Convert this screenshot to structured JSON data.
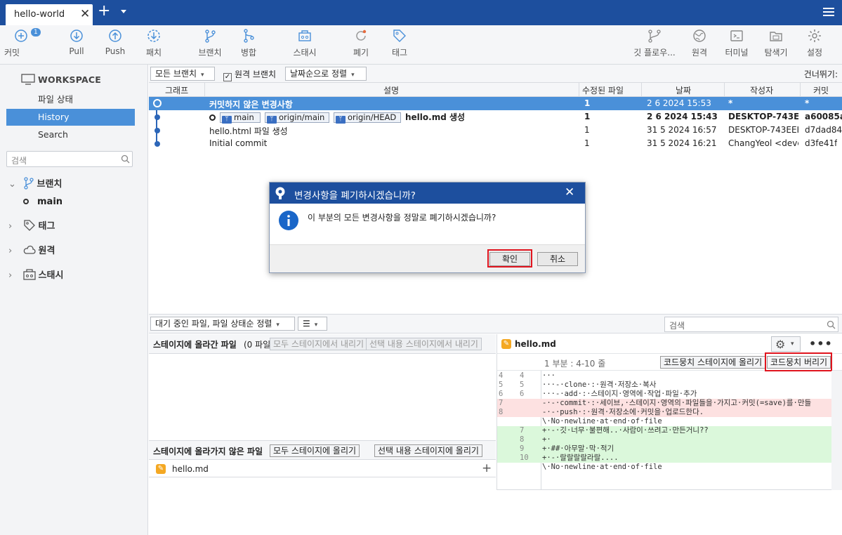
{
  "titlebar": {
    "tab_title": "hello-world",
    "close_glyph": "✕",
    "new_tab_glyph": "+"
  },
  "toolbar": {
    "commit": "커밋",
    "commit_badge": "1",
    "pull": "Pull",
    "push": "Push",
    "patch": "패치",
    "branch": "브랜치",
    "merge": "병합",
    "stash": "스태시",
    "discard": "폐기",
    "tag": "태그",
    "gitflow": "깃 플로우...",
    "remote": "원격",
    "terminal": "터미널",
    "explorer": "탐색기",
    "settings": "설정"
  },
  "sidebar": {
    "workspace": "WORKSPACE",
    "file_status": "파일 상태",
    "history": "History",
    "search": "Search",
    "search_placeholder": "검색",
    "branches": "브랜치",
    "branch_main": "main",
    "tags": "태그",
    "remotes": "원격",
    "stashes": "스태시"
  },
  "filter": {
    "all_branches": "모든 브랜치",
    "remote_branches": "원격 브랜치",
    "remote_checked": true,
    "sort": "날짜순으로 정렬",
    "skip": "건너뛰기:"
  },
  "table": {
    "headers": [
      "그래프",
      "설명",
      "수정된 파일",
      "날짜",
      "작성자",
      "커밋"
    ],
    "rows": [
      {
        "desc": "커밋하지 않은 변경사항",
        "files": "1",
        "date": "2 6 2024 15:53",
        "author": "*",
        "commit": "*"
      },
      {
        "refs": [
          "main",
          "origin/main",
          "origin/HEAD"
        ],
        "desc": "hello.md 생성",
        "files": "1",
        "date": "2 6 2024 15:43",
        "author": "DESKTOP-743EEH",
        "commit": "a60085a"
      },
      {
        "desc": "hello.html 파일 생성",
        "files": "1",
        "date": "31 5 2024 16:57",
        "author": "DESKTOP-743EEH",
        "commit": "d7dad84"
      },
      {
        "desc": "Initial commit",
        "files": "1",
        "date": "31 5 2024 16:21",
        "author": "ChangYeol <devcy",
        "commit": "d3fe41f"
      }
    ]
  },
  "bottom": {
    "sort_dd": "대기 중인 파일, 파일 상태순 정렬",
    "search_placeholder": "검색",
    "staged_title": "스테이지에 올라간 파일",
    "staged_count": "(0 파일)",
    "unstage_all": "모두 스테이지에서 내리기",
    "unstage_sel": "선택 내용 스테이지에서 내리기",
    "unstaged_title": "스테이지에 올라가지 않은 파일",
    "stage_all": "모두 스테이지에 올리기",
    "stage_sel": "선택 내용 스테이지에 올리기",
    "file": "hello.md"
  },
  "diff": {
    "file": "hello.md",
    "hunk": "1 부분 : 4-10 줄",
    "stage_hunk": "코드뭉치 스테이지에 올리기",
    "discard_hunk": "코드뭉치 버리기",
    "lines": [
      {
        "o": "4",
        "n": "4",
        "t": "···",
        "k": "ctx"
      },
      {
        "o": "5",
        "n": "5",
        "t": "···-·clone·:·원격·저장소·복사",
        "k": "ctx"
      },
      {
        "o": "6",
        "n": "6",
        "t": "···-·add·:·스테이지·영역에·작업·파일·추가",
        "k": "ctx"
      },
      {
        "o": "7",
        "n": "",
        "t": "-·-·commit·:·세이브,·스테이지·영역의·파일들을·가지고·커밋(=save)를·만들",
        "k": "del"
      },
      {
        "o": "8",
        "n": "",
        "t": "-·-·push·:·원격·저장소에·커밋을·업로드한다.",
        "k": "del"
      },
      {
        "o": "",
        "n": "",
        "t": "\\·No·newline·at·end·of·file",
        "k": "ctx"
      },
      {
        "o": "",
        "n": "7",
        "t": "+·-·깃·너무·불편해..·사람이·쓰려고·만든거니??",
        "k": "add"
      },
      {
        "o": "",
        "n": "8",
        "t": "+·",
        "k": "add"
      },
      {
        "o": "",
        "n": "9",
        "t": "+·##·아무말·막·적기",
        "k": "add"
      },
      {
        "o": "",
        "n": "10",
        "t": "+·-·랄랄랄랄라랄....",
        "k": "add"
      },
      {
        "o": "",
        "n": "",
        "t": "\\·No·newline·at·end·of·file",
        "k": "ctx"
      }
    ]
  },
  "dialog": {
    "title": "변경사항을 폐기하시겠습니까?",
    "message": "이 부분의 모든 변경사항을 정말로 폐기하시겠습니까?",
    "ok": "확인",
    "cancel": "취소"
  },
  "colors": {
    "titlebar": "#1d4f9e",
    "selection": "#4a90d9",
    "highlight_box": "#e0141e"
  }
}
